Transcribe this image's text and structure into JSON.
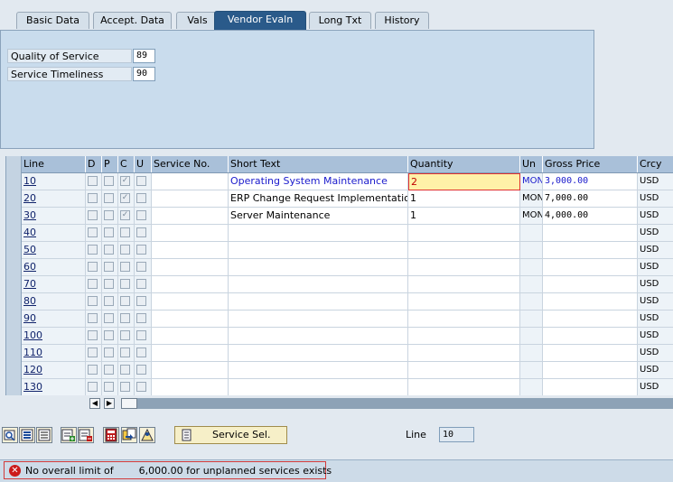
{
  "tabs": [
    {
      "label": "Basic Data",
      "active": false
    },
    {
      "label": "Accept. Data",
      "active": false
    },
    {
      "label": "Vals",
      "active": false
    },
    {
      "label": "Vendor Evaln",
      "active": true
    },
    {
      "label": "Long Txt",
      "active": false
    },
    {
      "label": "History",
      "active": false
    }
  ],
  "vendor_evaln": {
    "quality_label": "Quality of Service",
    "quality_value": "89",
    "timeliness_label": "Service Timeliness",
    "timeliness_value": "90"
  },
  "table": {
    "headers": [
      "Line",
      "D",
      "P",
      "C",
      "U",
      "Service No.",
      "Short Text",
      "Quantity",
      "Un",
      "Gross Price",
      "Crcy"
    ],
    "rows": [
      {
        "line": "10",
        "c": true,
        "service_no": "",
        "short_text": "Operating System Maintenance",
        "quantity": "2",
        "un": "MON",
        "gross_price": "3,000.00",
        "crcy": "USD"
      },
      {
        "line": "20",
        "c": true,
        "service_no": "",
        "short_text": "ERP Change Request Implementation",
        "quantity": "1",
        "un": "MON",
        "gross_price": "7,000.00",
        "crcy": "USD"
      },
      {
        "line": "30",
        "c": true,
        "service_no": "",
        "short_text": "Server Maintenance",
        "quantity": "1",
        "un": "MON",
        "gross_price": "4,000.00",
        "crcy": "USD"
      },
      {
        "line": "40",
        "c": false,
        "service_no": "",
        "short_text": "",
        "quantity": "",
        "un": "",
        "gross_price": "",
        "crcy": "USD"
      },
      {
        "line": "50",
        "c": false,
        "service_no": "",
        "short_text": "",
        "quantity": "",
        "un": "",
        "gross_price": "",
        "crcy": "USD"
      },
      {
        "line": "60",
        "c": false,
        "service_no": "",
        "short_text": "",
        "quantity": "",
        "un": "",
        "gross_price": "",
        "crcy": "USD"
      },
      {
        "line": "70",
        "c": false,
        "service_no": "",
        "short_text": "",
        "quantity": "",
        "un": "",
        "gross_price": "",
        "crcy": "USD"
      },
      {
        "line": "80",
        "c": false,
        "service_no": "",
        "short_text": "",
        "quantity": "",
        "un": "",
        "gross_price": "",
        "crcy": "USD"
      },
      {
        "line": "90",
        "c": false,
        "service_no": "",
        "short_text": "",
        "quantity": "",
        "un": "",
        "gross_price": "",
        "crcy": "USD"
      },
      {
        "line": "100",
        "c": false,
        "service_no": "",
        "short_text": "",
        "quantity": "",
        "un": "",
        "gross_price": "",
        "crcy": "USD"
      },
      {
        "line": "110",
        "c": false,
        "service_no": "",
        "short_text": "",
        "quantity": "",
        "un": "",
        "gross_price": "",
        "crcy": "USD"
      },
      {
        "line": "120",
        "c": false,
        "service_no": "",
        "short_text": "",
        "quantity": "",
        "un": "",
        "gross_price": "",
        "crcy": "USD"
      },
      {
        "line": "130",
        "c": false,
        "service_no": "",
        "short_text": "",
        "quantity": "",
        "un": "",
        "gross_price": "",
        "crcy": "USD"
      }
    ]
  },
  "toolbar": {
    "icons": [
      "details-icon",
      "select-all-icon",
      "deselect-all-icon",
      "insert-row-icon",
      "delete-row-icon",
      "calculator-icon",
      "copy-icon",
      "find-icon"
    ],
    "service_sel_label": "Service Sel."
  },
  "line_field": {
    "label": "Line",
    "value": "10"
  },
  "status": {
    "message": "No overall limit of        6,000.00 for unplanned services exists",
    "type": "error"
  }
}
